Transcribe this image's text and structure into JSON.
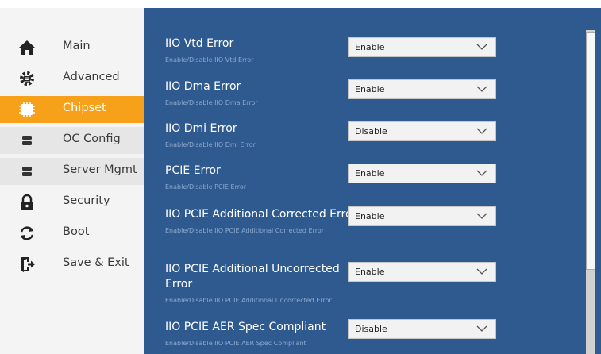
{
  "sidebar": {
    "items": [
      {
        "label": "Main",
        "icon": "home-icon"
      },
      {
        "label": "Advanced",
        "icon": "gear-icon"
      },
      {
        "label": "Chipset",
        "icon": "chip-icon",
        "selected": true
      },
      {
        "label": "OC Config",
        "icon": "memory-icon"
      },
      {
        "label": "Server Mgmt",
        "icon": "memory-icon"
      },
      {
        "label": "Security",
        "icon": "lock-icon"
      },
      {
        "label": "Boot",
        "icon": "refresh-icon"
      },
      {
        "label": "Save & Exit",
        "icon": "exit-icon"
      }
    ]
  },
  "settings": [
    {
      "title": "IIO Vtd Error",
      "description": "Enable/Disable IIO Vtd Error",
      "value": "Enable"
    },
    {
      "title": "IIO Dma Error",
      "description": "Enable/Disable IIO Dma Error",
      "value": "Enable"
    },
    {
      "title": "IIO Dmi Error",
      "description": "Enable/Disable IIO Dmi Error",
      "value": "Disable"
    },
    {
      "title": "PCIE Error",
      "description": "Enable/Disable PCIE Error",
      "value": "Enable"
    },
    {
      "title": "IIO PCIE Additional Corrected Error",
      "description": "Enable/Disable IIO PCIE Additional Corrected Error",
      "value": "Enable"
    },
    {
      "title": "IIO PCIE Additional Uncorrected Error",
      "description": "Enable/Disable IIO PCIE Additional Uncorrected Error",
      "value": "Enable"
    },
    {
      "title": "IIO PCIE AER Spec Compliant",
      "description": "Enable/Disable IIO PCIE AER Spec Compliant",
      "value": "Disable"
    }
  ],
  "colors": {
    "accent": "#f7a11a",
    "panel": "#2e5a8f",
    "sidebar": "#f4f4f4"
  }
}
